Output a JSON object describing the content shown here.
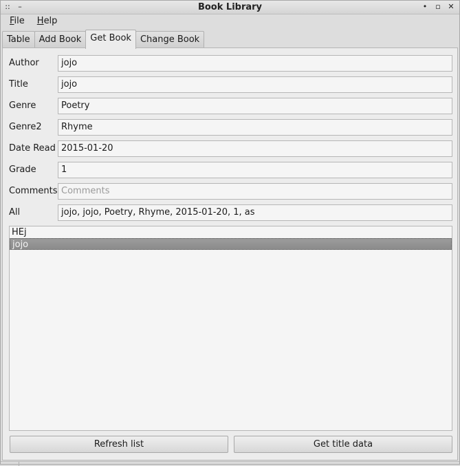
{
  "window": {
    "title": "Book Library"
  },
  "titlebar": {
    "left_icons": [
      "::",
      "–"
    ],
    "right_icons": [
      "•",
      "▫",
      "✕"
    ]
  },
  "menubar": {
    "items": [
      {
        "label": "File",
        "mnemonic": "F",
        "rest": "ile"
      },
      {
        "label": "Help",
        "mnemonic": "H",
        "rest": "elp"
      }
    ]
  },
  "tabs": [
    {
      "label": "Table",
      "active": false
    },
    {
      "label": "Add Book",
      "active": false
    },
    {
      "label": "Get Book",
      "active": true
    },
    {
      "label": "Change Book",
      "active": false
    }
  ],
  "form": {
    "author": {
      "label": "Author",
      "value": "jojo"
    },
    "title": {
      "label": "Title",
      "value": "jojo"
    },
    "genre": {
      "label": "Genre",
      "value": "Poetry"
    },
    "genre2": {
      "label": "Genre2",
      "value": "Rhyme"
    },
    "date_read": {
      "label": "Date Read",
      "value": "2015-01-20"
    },
    "grade": {
      "label": "Grade",
      "value": "1"
    },
    "comments": {
      "label": "Comments",
      "value": "",
      "placeholder": "Comments"
    },
    "all": {
      "label": "All",
      "value": "jojo, jojo, Poetry, Rhyme, 2015-01-20, 1, as"
    }
  },
  "list": {
    "items": [
      {
        "text": "HEj",
        "selected": false
      },
      {
        "text": "jojo",
        "selected": true
      }
    ]
  },
  "buttons": {
    "refresh": "Refresh list",
    "get_title": "Get title data"
  }
}
